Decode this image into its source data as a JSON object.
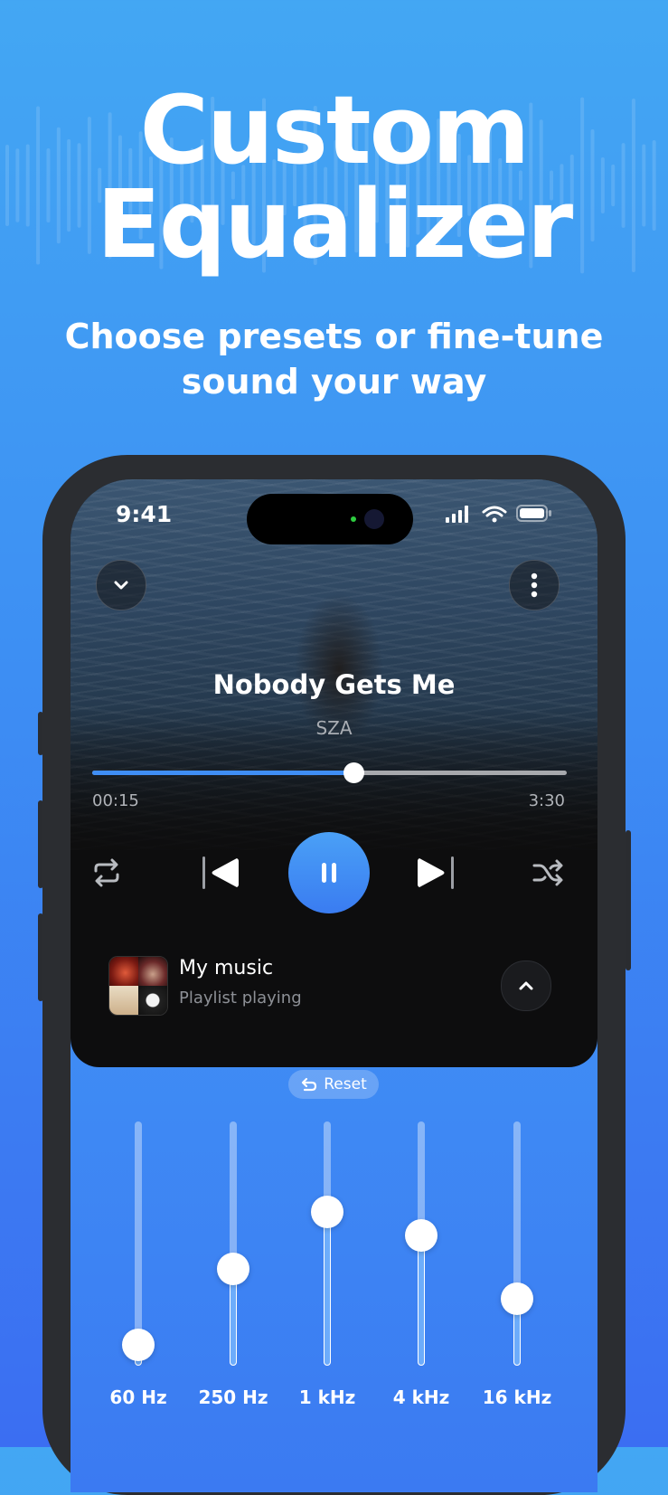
{
  "headline": {
    "line1": "Custom",
    "line2": "Equalizer"
  },
  "subheadline": "Choose presets or fine-tune sound your way",
  "status_bar": {
    "time": "9:41"
  },
  "now_playing": {
    "title": "Nobody Gets Me",
    "artist": "SZA",
    "elapsed": "00:15",
    "duration": "3:30",
    "progress_fraction": 0.55
  },
  "playlist": {
    "name": "My music",
    "status": "Playlist playing"
  },
  "equalizer": {
    "reset_label": "Reset",
    "bands": [
      {
        "label": "60 Hz",
        "level": 0.02
      },
      {
        "label": "250 Hz",
        "level": 0.38
      },
      {
        "label": "1 kHz",
        "level": 0.65
      },
      {
        "label": "4 kHz",
        "level": 0.54
      },
      {
        "label": "16 kHz",
        "level": 0.24
      }
    ]
  },
  "colors": {
    "accent": "#3f8ef5",
    "background_top": "#43a7f3",
    "background_bottom": "#3b6ef2"
  }
}
